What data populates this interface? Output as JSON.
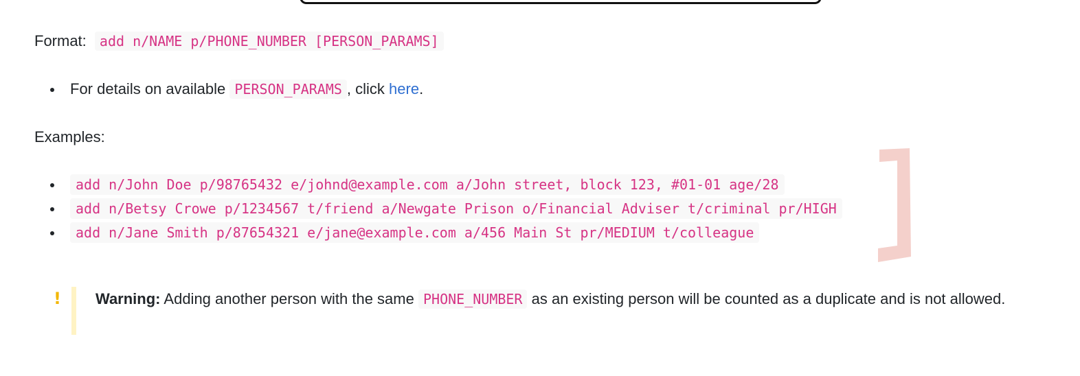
{
  "format": {
    "label": "Format:",
    "code": "add n/NAME p/PHONE_NUMBER [PERSON_PARAMS]"
  },
  "details": {
    "prefix": "For details on available",
    "code": "PERSON_PARAMS",
    "middle": ", click",
    "link": "here",
    "suffix": "."
  },
  "examples": {
    "label": "Examples:",
    "items": [
      "add n/John Doe p/98765432 e/johnd@example.com a/John street, block 123, #01-01 age/28",
      "add n/Betsy Crowe p/1234567 t/friend a/Newgate Prison o/Financial Adviser t/criminal pr/HIGH",
      "add n/Jane Smith p/87654321 e/jane@example.com a/456 Main St pr/MEDIUM t/colleague"
    ]
  },
  "warning": {
    "icon": "exclamation-icon",
    "title": "Warning:",
    "text_before": "Adding another person with the same",
    "code": "PHONE_NUMBER",
    "text_after": "as an existing person will be counted as a duplicate and is not allowed."
  },
  "colors": {
    "code_text": "#d63384",
    "code_background": "#f8f8f8",
    "link": "#2f6fd1",
    "warning_icon": "#f2b705",
    "warning_bar": "#fff3c4",
    "bracket_doodle": "#f4d0cb"
  }
}
